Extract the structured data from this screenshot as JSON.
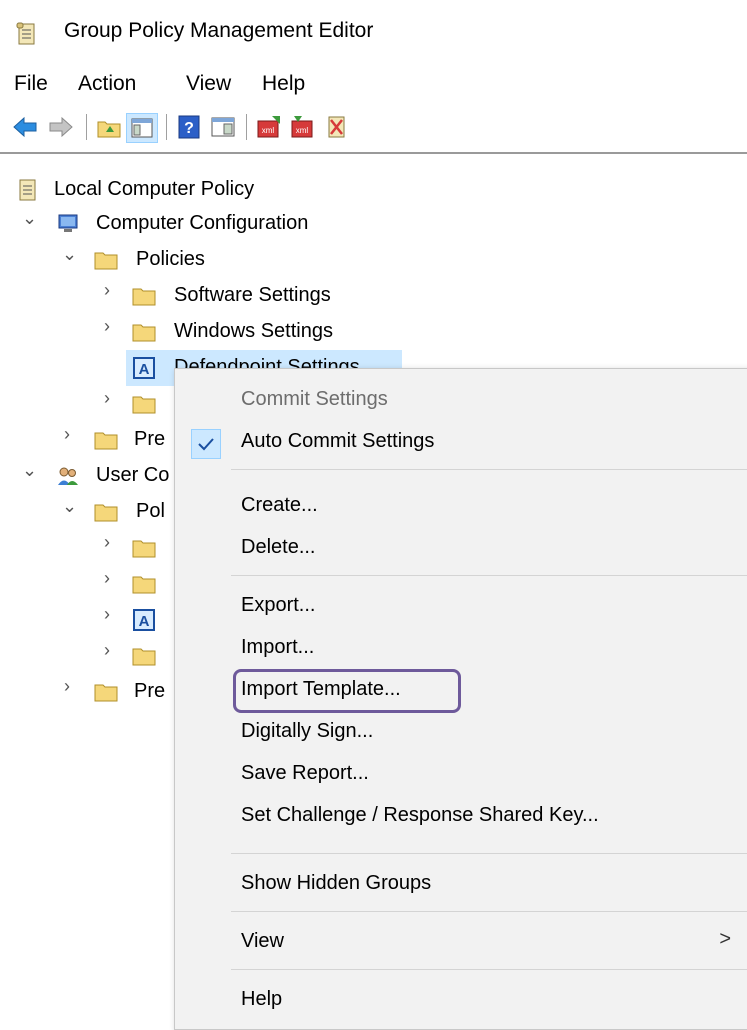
{
  "window": {
    "title": "Group Policy Management Editor"
  },
  "menubar": {
    "file": "File",
    "action": "Action",
    "view": "View",
    "help": "Help"
  },
  "toolbar": {
    "icons": [
      "back-arrow-icon",
      "forward-arrow-icon",
      "up-folder-icon",
      "show-hide-tree-icon",
      "help-icon",
      "action-pane-icon",
      "export-xml-icon",
      "import-xml-icon",
      "clear-icon"
    ]
  },
  "tree": {
    "root": "Local Computer Policy",
    "computer_config": "Computer Configuration",
    "policies": "Policies",
    "software_settings": "Software Settings",
    "windows_settings": "Windows Settings",
    "defendpoint_settings": "Defendpoint Settings",
    "preferences": "Pre",
    "user_config": "User Co",
    "user_policies": "Pol",
    "user_preferences": "Pre"
  },
  "context_menu": {
    "commit_settings": "Commit Settings",
    "auto_commit_settings": "Auto Commit Settings",
    "create": "Create...",
    "delete": "Delete...",
    "export": "Export...",
    "import": "Import...",
    "import_template": "Import Template...",
    "digitally_sign": "Digitally Sign...",
    "save_report": "Save Report...",
    "set_challenge": "Set Challenge / Response Shared Key...",
    "show_hidden_groups": "Show Hidden Groups",
    "view": "View",
    "view_submenu_arrow": ">",
    "help": "Help"
  },
  "colors": {
    "selection_bg": "#cce8ff",
    "menu_bg": "#f2f2f2",
    "highlight_border": "#6e5a9b",
    "folder_yellow": "#f5d77a"
  }
}
